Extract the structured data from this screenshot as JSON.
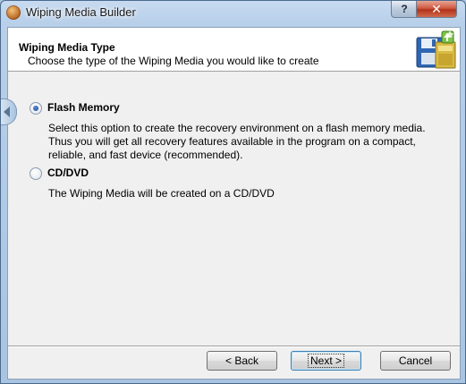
{
  "window": {
    "title": "Wiping Media Builder",
    "help_label": "?",
    "close_label": "✕"
  },
  "header": {
    "title": "Wiping Media Type",
    "subtitle": "Choose the type of the Wiping Media you would like to create",
    "icon": "floppy-disk-wizard-icon"
  },
  "options": [
    {
      "label": "Flash Memory",
      "selected": true,
      "description": "Select this option to create the recovery environment on a flash memory media. Thus you will get all recovery features available in the program on a compact, reliable, and fast device (recommended)."
    },
    {
      "label": "CD/DVD",
      "selected": false,
      "description": "The Wiping Media will be created on a CD/DVD"
    }
  ],
  "buttons": {
    "back": "< Back",
    "next": "Next >",
    "cancel": "Cancel"
  },
  "colors": {
    "titlebar": "#b8cfe9",
    "accent": "#3c7fb1"
  }
}
